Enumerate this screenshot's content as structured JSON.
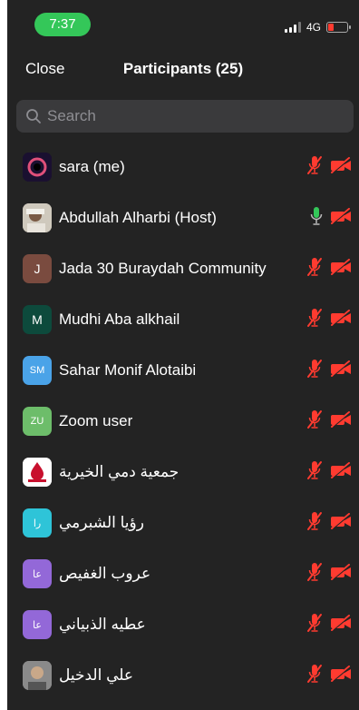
{
  "status_bar": {
    "time": "7:37",
    "network": "4G"
  },
  "nav": {
    "close_label": "Close",
    "title": "Participants (25)"
  },
  "search": {
    "placeholder": "Search"
  },
  "colors": {
    "background": "#232323",
    "muted": "#ff3b30",
    "unmuted_mic": "#34c759",
    "time_pill": "#34c759"
  },
  "participants": [
    {
      "name": "sara (me)",
      "avatar_text": "",
      "avatar_color": "#1a1030",
      "mic": "muted",
      "video": "off"
    },
    {
      "name": "Abdullah Alharbi (Host)",
      "avatar_text": "",
      "avatar_color": "#b9b4a8",
      "mic": "on",
      "video": "off"
    },
    {
      "name": "Jada 30 Buraydah Community",
      "avatar_text": "J",
      "avatar_color": "#7a4b3f",
      "mic": "muted",
      "video": "off"
    },
    {
      "name": "Mudhi Aba alkhail",
      "avatar_text": "M",
      "avatar_color": "#0d4a3c",
      "mic": "muted",
      "video": "off"
    },
    {
      "name": "Sahar Monif Alotaibi",
      "avatar_text": "SM",
      "avatar_color": "#4aa3e8",
      "mic": "muted",
      "video": "off"
    },
    {
      "name": "Zoom user",
      "avatar_text": "ZU",
      "avatar_color": "#6dbd6a",
      "mic": "muted",
      "video": "off"
    },
    {
      "name": "جمعية دمي الخيرية",
      "avatar_text": "",
      "avatar_color": "#ffffff",
      "mic": "muted",
      "video": "off"
    },
    {
      "name": "رؤيا الشبرمي",
      "avatar_text": "را",
      "avatar_color": "#2ec4d8",
      "mic": "muted",
      "video": "off"
    },
    {
      "name": "عروب الغفيص",
      "avatar_text": "عا",
      "avatar_color": "#9368d8",
      "mic": "muted",
      "video": "off"
    },
    {
      "name": "عطيه الذبياني",
      "avatar_text": "عا",
      "avatar_color": "#9368d8",
      "mic": "muted",
      "video": "off"
    },
    {
      "name": "علي الدخيل",
      "avatar_text": "",
      "avatar_color": "#8a8a8a",
      "mic": "muted",
      "video": "off"
    }
  ]
}
